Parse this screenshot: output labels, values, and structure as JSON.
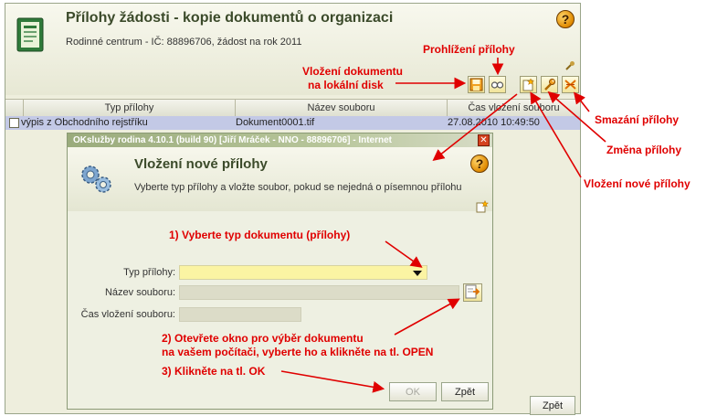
{
  "main_window": {
    "title": "Přílohy žádosti - kopie dokumentů o organizaci",
    "subtitle": "Rodinné centrum - IČ: 88896706, žádost na rok 2011",
    "back_label": "Zpět",
    "toolbar_icons": [
      "save-disk-icon",
      "view-glasses-icon",
      "add-new-icon",
      "edit-wrench-icon",
      "delete-icon"
    ],
    "table": {
      "columns": [
        "Typ přílohy",
        "Název souboru",
        "Čas vložení souboru"
      ],
      "rows": [
        {
          "type": "výpis z Obchodního rejstříku",
          "filename": "Dokument0001.tif",
          "time": "27.08.2010 10:49:50"
        }
      ]
    }
  },
  "dialog": {
    "title": "OKslužby rodina 4.10.1 (build 90)  [Jiří Mráček - NNO - 88896706] - Internet",
    "heading": "Vložení nové přílohy",
    "description": "Vyberte typ přílohy a vložte soubor, pokud se nejedná o písemnou přílohu",
    "fields": {
      "type_label": "Typ přílohy:",
      "type_value": "",
      "filename_label": "Název souboru:",
      "filename_value": "",
      "time_label": "Čas vložení souboru:",
      "time_value": ""
    },
    "ok_label": "OK",
    "back_label": "Zpět"
  },
  "annotations": {
    "view": "Prohlížení přílohy",
    "download_line1": "Vložení dokumentu",
    "download_line2": "na lokální disk",
    "delete": "Smazání přílohy",
    "edit": "Změna přílohy",
    "add": "Vložení nové přílohy",
    "step1": "1) Vyberte typ dokumentu (přílohy)",
    "step2_line1": "2) Otevřete okno pro výběr dokumentu",
    "step2_line2": "na vašem počítači, vyberte ho a klikněte na tl. OPEN",
    "step3": "3) Klikněte na tl. OK",
    "color": "#e00000"
  },
  "colors": {
    "window_bg": "#eeeedd",
    "title_text": "#3b4a2a",
    "selected_row": "#c3c9e6",
    "select_field": "#fbf4a3",
    "titlebar": "#9aab7c"
  }
}
